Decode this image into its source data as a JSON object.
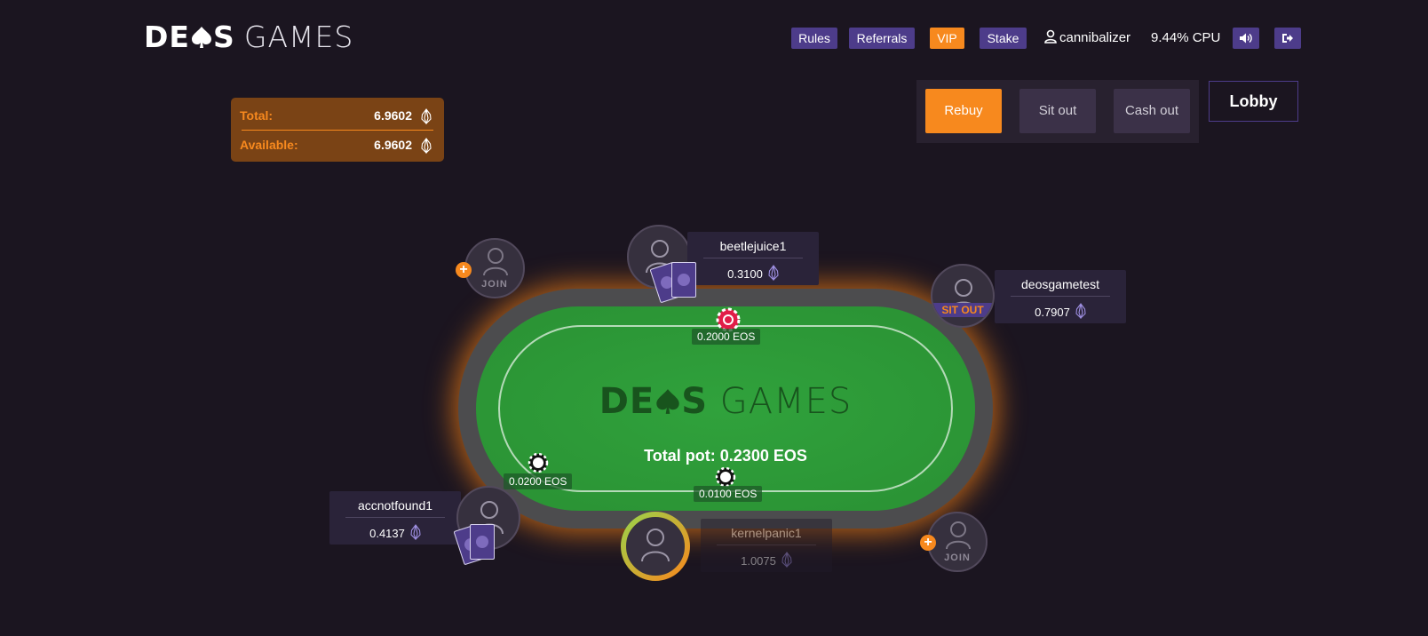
{
  "header": {
    "logo_bold": "DE",
    "logo_bold_end": "S",
    "logo_light": "GAMES",
    "nav": [
      "Rules",
      "Referrals",
      "VIP",
      "Stake"
    ],
    "username": "cannibalizer",
    "cpu": "9.44% CPU"
  },
  "balance": {
    "total_label": "Total:",
    "total_value": "6.9602",
    "available_label": "Available:",
    "available_value": "6.9602"
  },
  "actions": {
    "rebuy": "Rebuy",
    "sit_out": "Sit out",
    "cash_out": "Cash out",
    "lobby": "Lobby"
  },
  "table": {
    "logo_bold": "DE",
    "logo_bold_end": "S",
    "logo_light": "GAMES",
    "total_pot": "Total pot: 0.2300 EOS",
    "bets": {
      "top": "0.2000 EOS",
      "left": "0.0200 EOS",
      "bottom": "0.0100 EOS"
    }
  },
  "seats": {
    "join_label": "JOIN",
    "beetlejuice": {
      "name": "beetlejuice1",
      "stack": "0.3100"
    },
    "deosgametest": {
      "name": "deosgametest",
      "stack": "0.7907",
      "status": "SIT OUT"
    },
    "accnotfound": {
      "name": "accnotfound1",
      "stack": "0.4137"
    },
    "kernelpanic": {
      "name": "kernelpanic1",
      "stack": "1.0075"
    }
  },
  "colors": {
    "accent": "#f7891e",
    "nav_purple": "#4d3c8a",
    "background": "#1b1520",
    "felt": "#2e9b39",
    "rail": "#4c4c4e"
  },
  "icons": {
    "user": "user-icon",
    "sound": "volume-icon",
    "logout": "logout-icon",
    "eos": "eos-icon",
    "plus": "plus-icon",
    "spade": "spade-icon"
  }
}
